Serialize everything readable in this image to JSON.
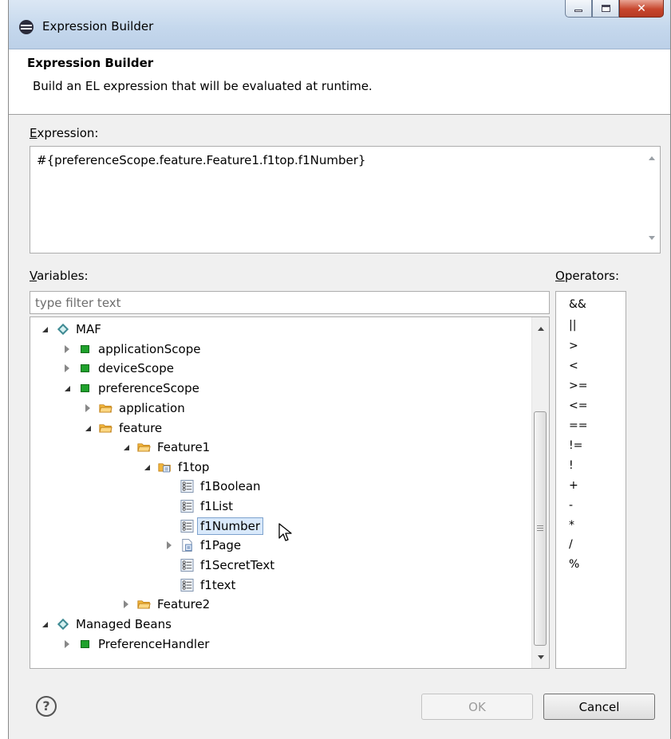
{
  "window": {
    "title": "Expression Builder"
  },
  "header": {
    "title": "Expression Builder",
    "description": "Build an EL expression that will be evaluated at runtime."
  },
  "expression": {
    "label_mnemonic": "E",
    "label_rest": "xpression:",
    "value": "#{preferenceScope.feature.Feature1.f1top.f1Number}"
  },
  "variables": {
    "label_mnemonic": "V",
    "label_rest": "ariables:",
    "filter_placeholder": "type filter text",
    "tree": [
      {
        "label": "MAF",
        "state": "expanded",
        "icon": "diamond-icon"
      },
      {
        "label": "applicationScope",
        "state": "collapsed",
        "icon": "scope-icon"
      },
      {
        "label": "deviceScope",
        "state": "collapsed",
        "icon": "scope-icon"
      },
      {
        "label": "preferenceScope",
        "state": "expanded",
        "icon": "scope-icon"
      },
      {
        "label": "application",
        "state": "collapsed",
        "icon": "folder-icon"
      },
      {
        "label": "feature",
        "state": "expanded",
        "icon": "folder-icon"
      },
      {
        "label": "Feature1",
        "state": "expanded",
        "icon": "folder-icon"
      },
      {
        "label": "f1top",
        "state": "expanded",
        "icon": "page-folder-icon"
      },
      {
        "label": "f1Boolean",
        "state": "leaf",
        "icon": "property-icon"
      },
      {
        "label": "f1List",
        "state": "leaf",
        "icon": "property-icon"
      },
      {
        "label": "f1Number",
        "state": "selected",
        "icon": "property-icon"
      },
      {
        "label": "f1Page",
        "state": "collapsed",
        "icon": "page-icon"
      },
      {
        "label": "f1SecretText",
        "state": "leaf",
        "icon": "property-icon"
      },
      {
        "label": "f1text",
        "state": "leaf",
        "icon": "property-icon"
      },
      {
        "label": "Feature2",
        "state": "collapsed",
        "icon": "folder-icon"
      },
      {
        "label": "Managed Beans",
        "state": "expanded",
        "icon": "diamond-icon"
      },
      {
        "label": "PreferenceHandler",
        "state": "collapsed",
        "icon": "scope-icon"
      }
    ]
  },
  "operators": {
    "label_mnemonic": "O",
    "label_rest": "perators:",
    "items": [
      "&&",
      "||",
      ">",
      "<",
      ">=",
      "<=",
      "==",
      "!=",
      "!",
      "+",
      "-",
      "*",
      "/",
      "%"
    ]
  },
  "buttons": {
    "ok": "OK",
    "cancel": "Cancel",
    "help": "?"
  },
  "colors": {
    "accent": "#1fa12c",
    "folder": "#f1b53c",
    "selection": "#d9e9fb"
  }
}
